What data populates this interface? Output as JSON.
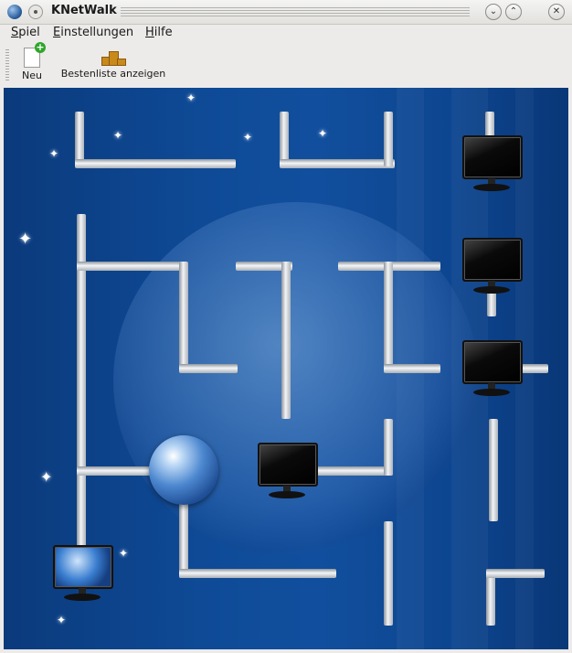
{
  "window": {
    "title": "KNetWalk",
    "app_icon": "knetwalk-globe-icon",
    "buttons": [
      "sticky-pin",
      "minimize",
      "maximize",
      "close"
    ]
  },
  "menu": {
    "items": [
      "Spiel",
      "Einstellungen",
      "Hilfe"
    ]
  },
  "toolbar": {
    "new_label": "Neu",
    "new_icon": "new-document-icon",
    "highscores_label": "Bestenliste anzeigen",
    "highscores_icon": "podium-icon"
  },
  "board": {
    "grid_columns": 5,
    "grid_rows": 5,
    "background_color": "#0e4a96",
    "pipe_color": "#dfe3e7",
    "server": "globe-server-icon",
    "terminal_icon": "monitor-icon",
    "terminal_count": 5
  }
}
